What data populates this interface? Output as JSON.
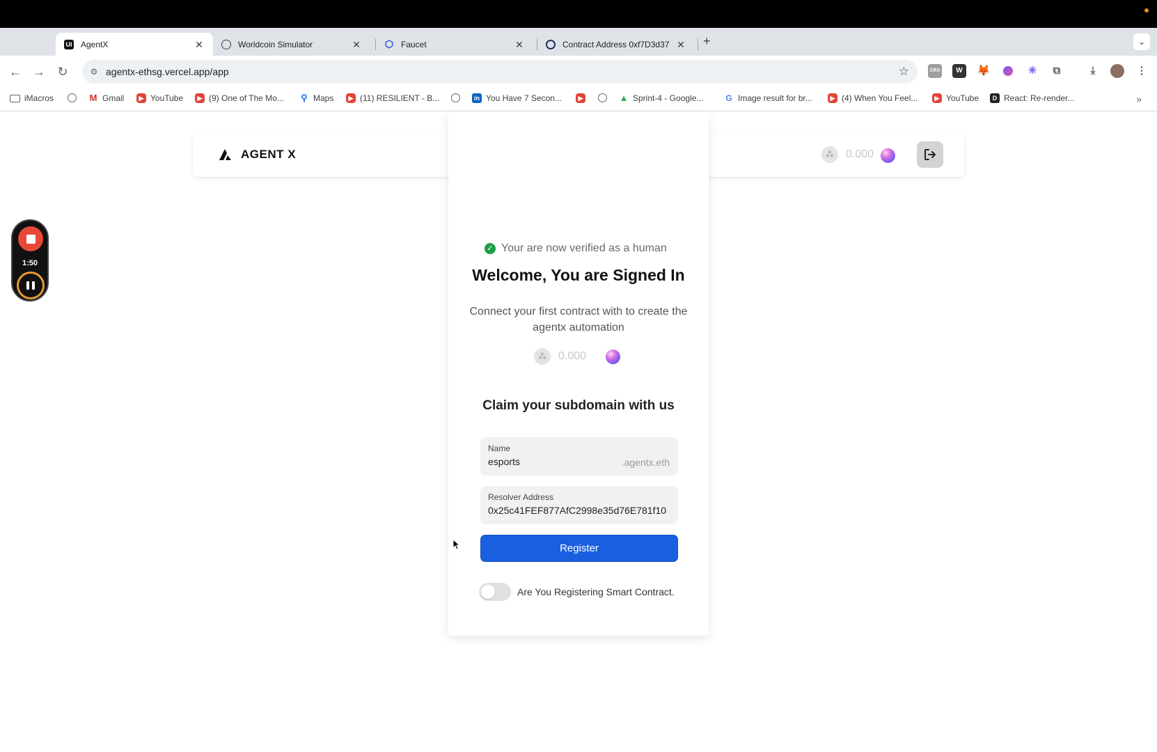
{
  "browser": {
    "tabs": [
      {
        "title": "AgentX",
        "favicon": "UI",
        "active": true
      },
      {
        "title": "Worldcoin Simulator",
        "favicon": "globe-icon",
        "active": false
      },
      {
        "title": "Faucet",
        "favicon": "hexagon-icon",
        "active": false
      },
      {
        "title": "Contract Address 0xf7D3d37",
        "favicon": "explorer-icon",
        "active": false
      }
    ],
    "url": "agentx-ethsg.vercel.app/app",
    "bookmarks": [
      {
        "label": "iMacros",
        "icon": "folder-icon"
      },
      {
        "label": "",
        "icon": "globe-icon"
      },
      {
        "label": "Gmail",
        "icon": "gmail-icon"
      },
      {
        "label": "YouTube",
        "icon": "youtube-icon"
      },
      {
        "label": "(9) One of The Mo...",
        "icon": "youtube-icon"
      },
      {
        "label": "Maps",
        "icon": "maps-icon"
      },
      {
        "label": "(11) RESILIENT - B...",
        "icon": "youtube-icon"
      },
      {
        "label": "",
        "icon": "globe-icon"
      },
      {
        "label": "You Have 7 Secon...",
        "icon": "linkedin-icon"
      },
      {
        "label": "",
        "icon": "youtube-icon"
      },
      {
        "label": "",
        "icon": "globe-icon"
      },
      {
        "label": "Sprint-4 - Google...",
        "icon": "drive-icon"
      },
      {
        "label": "Image result for br...",
        "icon": "google-icon"
      },
      {
        "label": "(4) When You Feel...",
        "icon": "youtube-icon"
      },
      {
        "label": "YouTube",
        "icon": "youtube-icon"
      },
      {
        "label": "React: Re-render...",
        "icon": "dev-icon"
      }
    ]
  },
  "recorder": {
    "time": "1:50"
  },
  "app": {
    "brand": "AGENT X",
    "balance": "0.000"
  },
  "card": {
    "verified_text": "Your are now verified as a human",
    "welcome": "Welcome, You are Signed In",
    "subtext": "Connect your first contract with to create the agentx automation",
    "balance": "0.000",
    "claim_title": "Claim your subdomain with us",
    "name_label": "Name",
    "name_value": "esports",
    "name_suffix": ".agentx.eth",
    "resolver_label": "Resolver Address",
    "resolver_value": "0x25c41FEF877AfC2998e35d76E781f10",
    "register_label": "Register",
    "toggle_label": "Are You Registering Smart Contract.",
    "toggle_on": false
  },
  "colors": {
    "primary": "#1a5fe0",
    "success": "#1e9e4a",
    "record": "#e8483a"
  }
}
